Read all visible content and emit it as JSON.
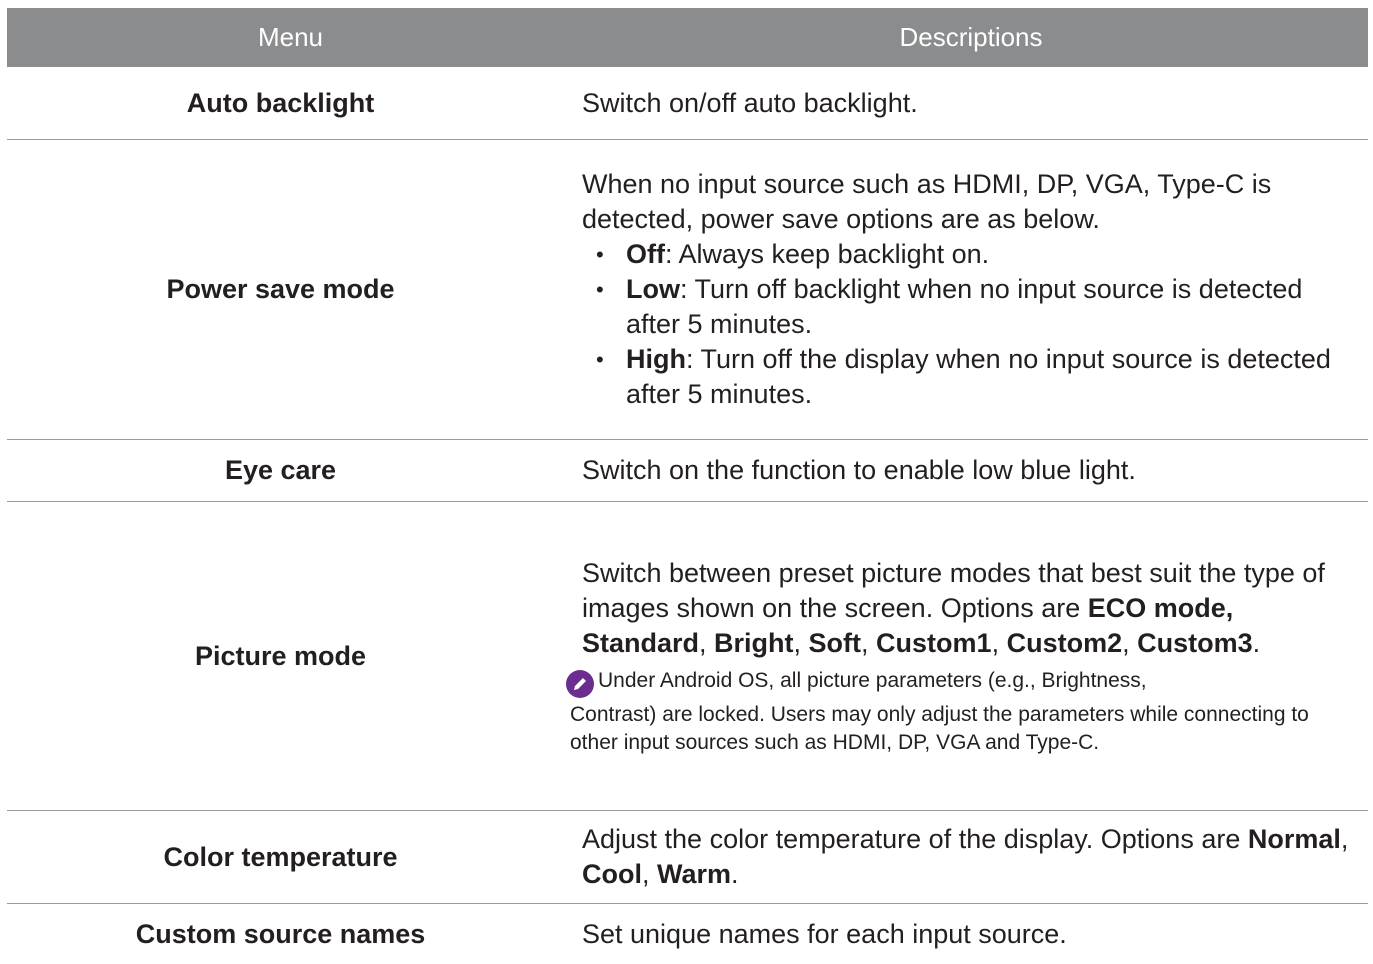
{
  "header": {
    "menu": "Menu",
    "descriptions": "Descriptions"
  },
  "rows": {
    "auto_backlight": {
      "name": "Auto backlight",
      "desc": "Switch on/off auto backlight."
    },
    "power_save": {
      "name": "Power save mode",
      "desc": "When no input source such as HDMI, DP, VGA, Type-C is detected, power save options are as below.",
      "bullets": [
        {
          "term": "Off",
          "text": ": Always keep backlight on."
        },
        {
          "term": "Low",
          "text": ": Turn off backlight when no input source is detected after 5 minutes."
        },
        {
          "term": "High",
          "text": ": Turn off the display when no input source is detected after 5 minutes."
        }
      ]
    },
    "eye_care": {
      "name": "Eye care",
      "desc": "Switch on the function to enable low blue light."
    },
    "picture_mode": {
      "name": "Picture mode",
      "desc": "Switch between preset picture modes that best suit the type of images shown on the screen. Options are ",
      "opt1": "ECO mode, Standard",
      "opt2": "Bright",
      "opt3": "Soft",
      "opt4": "Custom1",
      "opt5": "Custom2",
      "opt6": "Custom3",
      "sep": ", ",
      "end": ".",
      "note_line1": "Under Android OS, all picture parameters (e.g., Brightness,",
      "note_rest": "Contrast) are locked. Users may only adjust the parameters while connecting to other input sources such as HDMI, DP, VGA and Type-C."
    },
    "color_temp": {
      "name": "Color temperature",
      "desc": "Adjust the color temperature of the display. Options are ",
      "opt1": "Normal",
      "opt2": "Cool",
      "opt3": "Warm",
      "sep": ", ",
      "end": "."
    },
    "custom_source": {
      "name": "Custom source names",
      "desc": "Set unique names for each input source."
    }
  },
  "colors": {
    "header_bg": "#8a8c8e",
    "note_icon": "#6b2d8f"
  },
  "icons": {
    "note": "pencil-icon",
    "bullet": "bullet-dot"
  }
}
